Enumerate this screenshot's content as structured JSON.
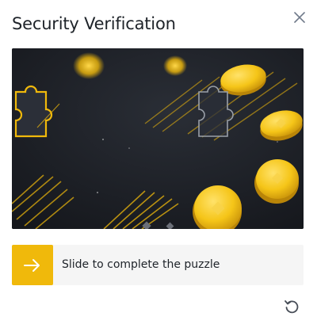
{
  "dialog": {
    "title": "Security Verification",
    "close_icon": "close-icon",
    "refresh_icon": "refresh-icon"
  },
  "puzzle": {
    "piece_icon": "puzzle-piece",
    "slot_icon": "puzzle-slot",
    "background_color": "#1a1d23",
    "accent_color": "#f0b90b"
  },
  "slider": {
    "label": "Slide to complete the puzzle",
    "handle_icon": "arrow-right-icon",
    "handle_color": "#f0b90b",
    "track_color": "#f5f5f5"
  }
}
